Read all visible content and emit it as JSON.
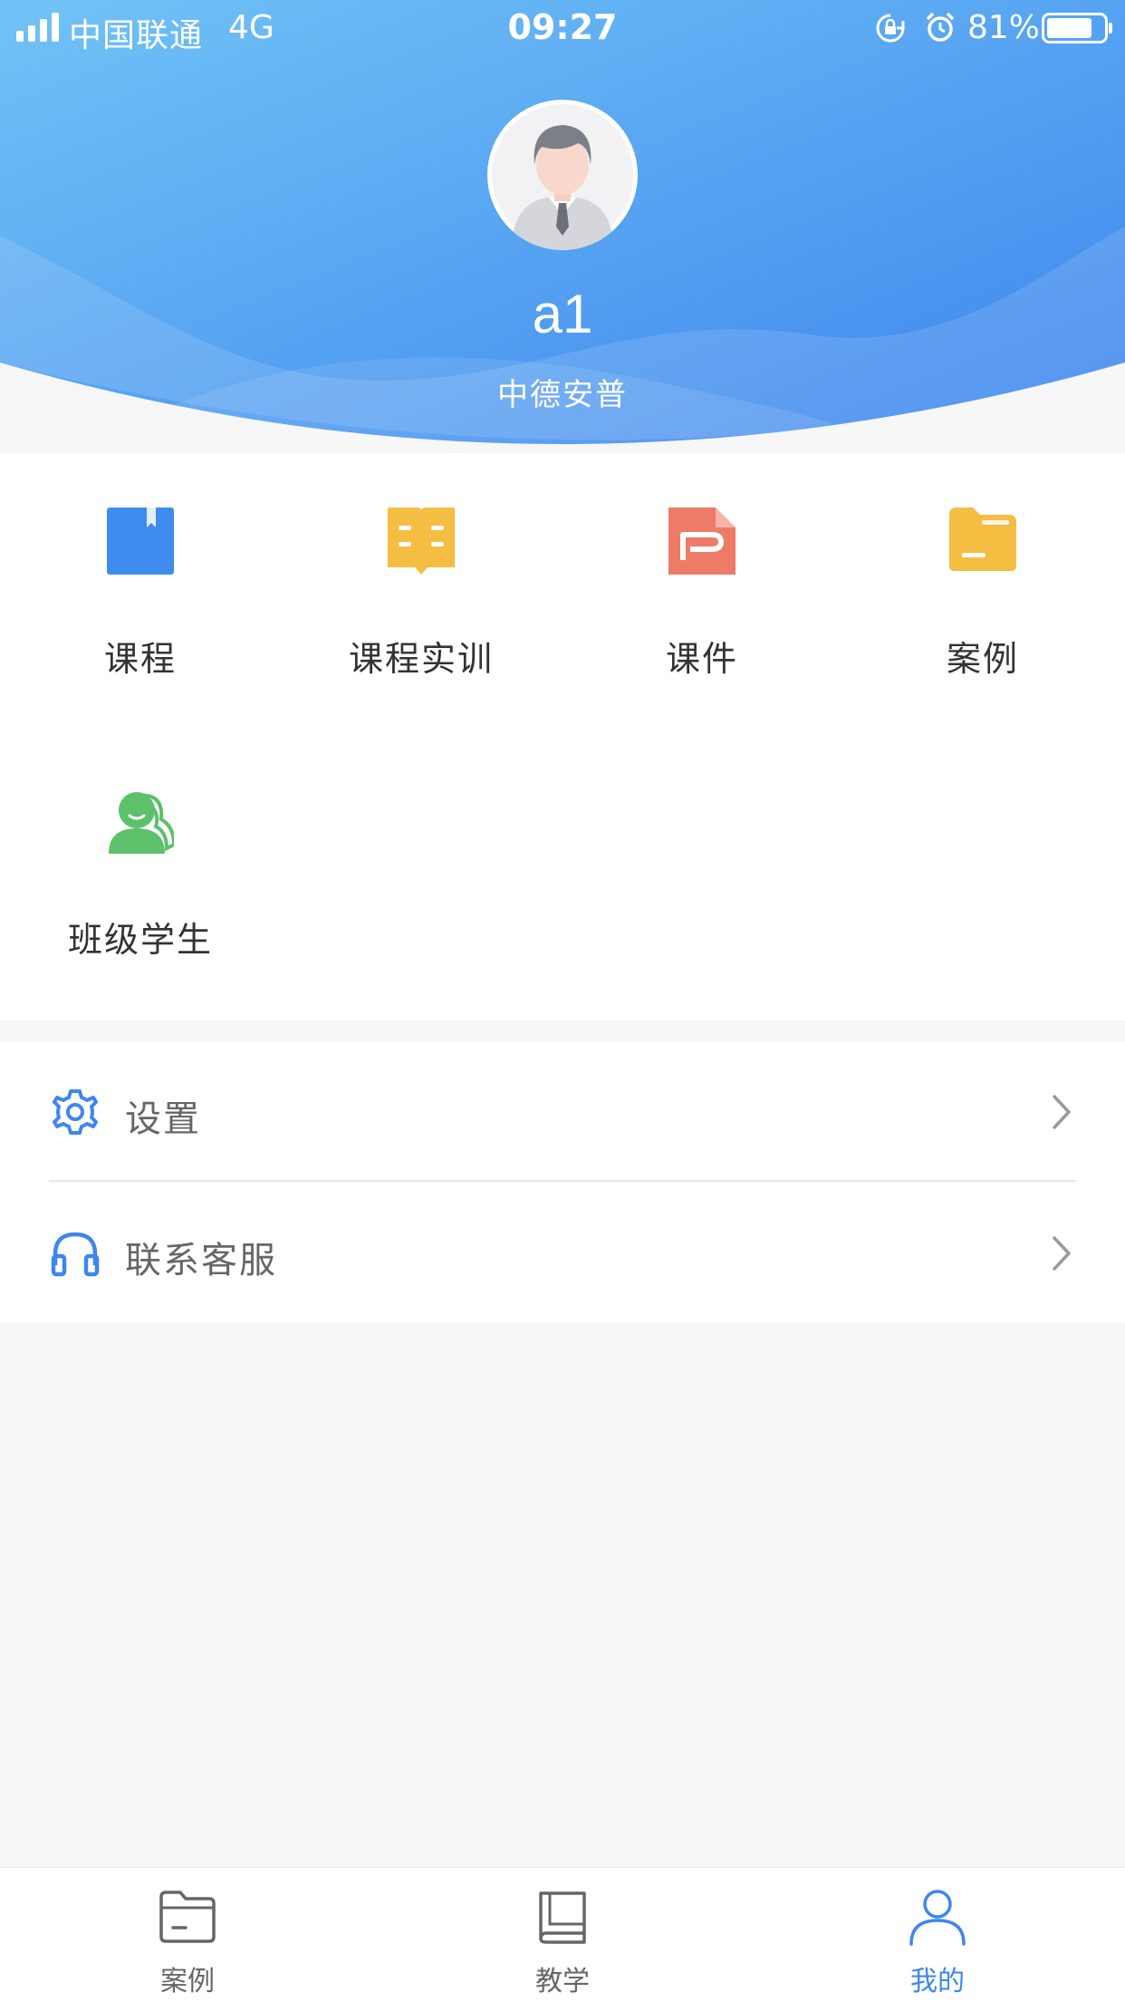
{
  "status_bar": {
    "carrier": "中国联通",
    "network": "4G",
    "time": "09:27",
    "battery": "81%",
    "battery_level": 0.81
  },
  "profile": {
    "name": "a1",
    "organization": "中德安普"
  },
  "grid": {
    "items": [
      {
        "label": "课程",
        "icon": "book-icon",
        "color": "#3f8cf0"
      },
      {
        "label": "课程实训",
        "icon": "open-book-icon",
        "color": "#f5bd42"
      },
      {
        "label": "课件",
        "icon": "ppt-file-icon",
        "color": "#ee7b68"
      },
      {
        "label": "案例",
        "icon": "folder-icon",
        "color": "#f5bd42"
      },
      {
        "label": "班级学生",
        "icon": "students-icon",
        "color": "#5dc06a"
      }
    ]
  },
  "menu": {
    "items": [
      {
        "label": "设置",
        "icon": "gear-icon"
      },
      {
        "label": "联系客服",
        "icon": "headset-icon"
      }
    ]
  },
  "tabbar": {
    "items": [
      {
        "label": "案例",
        "icon": "folder-icon",
        "active": false
      },
      {
        "label": "教学",
        "icon": "book-icon",
        "active": false
      },
      {
        "label": "我的",
        "icon": "user-icon",
        "active": true
      }
    ]
  },
  "colors": {
    "accent": "#3d86ee",
    "header_start": "#6cbdf4",
    "header_end": "#3f87ee",
    "text_primary": "#333333",
    "text_secondary": "#666666",
    "background": "#f6f6f6"
  }
}
